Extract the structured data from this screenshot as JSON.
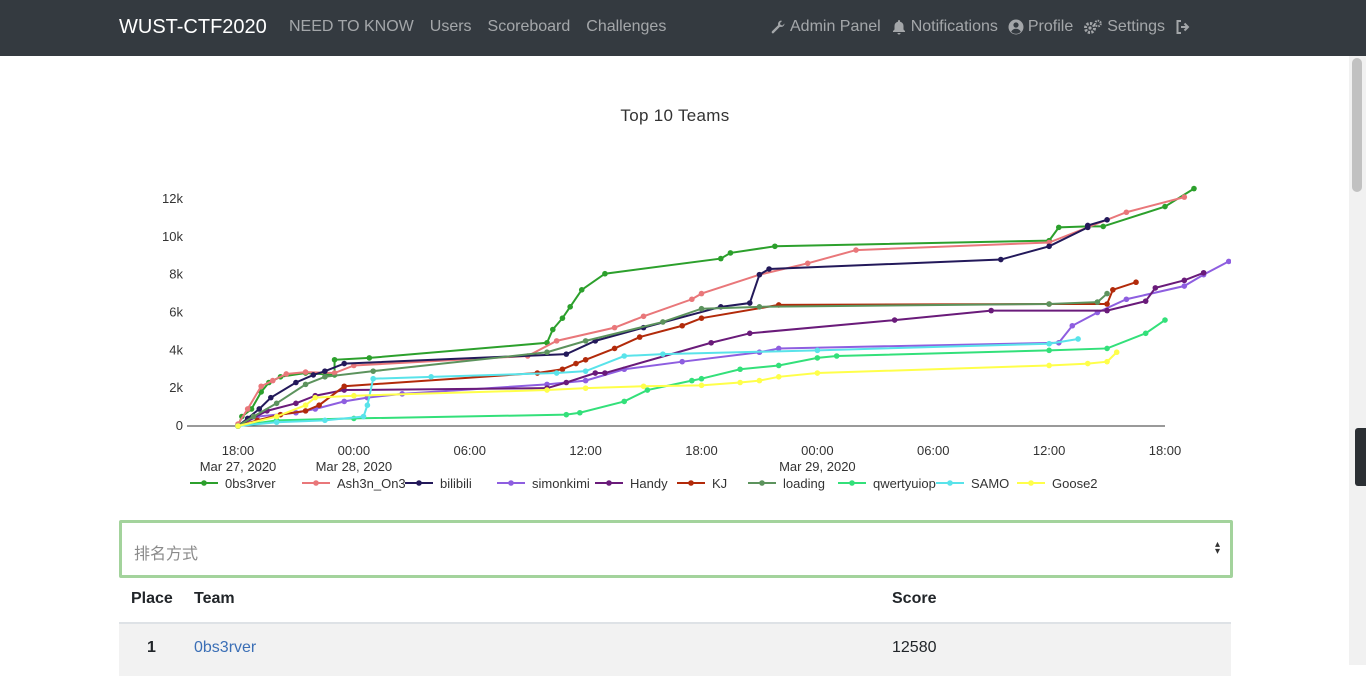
{
  "navbar": {
    "brand": "WUST-CTF2020",
    "left_links": [
      "NEED TO KNOW",
      "Users",
      "Scoreboard",
      "Challenges"
    ],
    "right_links": [
      {
        "label": "Admin Panel",
        "icon": "wrench-icon"
      },
      {
        "label": "Notifications",
        "icon": "bell-icon"
      },
      {
        "label": "Profile",
        "icon": "user-circle-icon"
      },
      {
        "label": "Settings",
        "icon": "cogs-icon"
      }
    ],
    "logout_icon": "sign-out-icon"
  },
  "chart_data": {
    "type": "line",
    "title": "Top 10 Teams",
    "ylim": [
      0,
      13000
    ],
    "yticks": [
      "0",
      "2k",
      "4k",
      "6k",
      "8k",
      "10k",
      "12k"
    ],
    "xticks": [
      {
        "label": "18:00",
        "sub": "Mar 27, 2020"
      },
      {
        "label": "00:00",
        "sub": "Mar 28, 2020"
      },
      {
        "label": "06:00",
        "sub": ""
      },
      {
        "label": "12:00",
        "sub": ""
      },
      {
        "label": "18:00",
        "sub": ""
      },
      {
        "label": "00:00",
        "sub": "Mar 29, 2020"
      },
      {
        "label": "06:00",
        "sub": ""
      },
      {
        "label": "12:00",
        "sub": ""
      },
      {
        "label": "18:00",
        "sub": ""
      }
    ],
    "x_hours": [
      -6,
      0,
      6,
      12,
      18,
      24,
      30,
      36,
      42
    ],
    "x_unit": "hours from Mar 28, 2020 00:00",
    "legend_position": "bottom",
    "series": [
      {
        "name": "0bs3rver",
        "color": "#2ca02c",
        "points": [
          [
            -6,
            0
          ],
          [
            -5.8,
            500
          ],
          [
            -5.3,
            900
          ],
          [
            -4.8,
            1800
          ],
          [
            -4.4,
            2300
          ],
          [
            -3.8,
            2600
          ],
          [
            -2.5,
            2800
          ],
          [
            -1,
            2700
          ],
          [
            -1,
            3500
          ],
          [
            0.8,
            3600
          ],
          [
            10,
            4400
          ],
          [
            10.3,
            5100
          ],
          [
            10.8,
            5700
          ],
          [
            11.2,
            6300
          ],
          [
            11.8,
            7200
          ],
          [
            13,
            8050
          ],
          [
            19,
            8850
          ],
          [
            19.5,
            9150
          ],
          [
            21.8,
            9500
          ],
          [
            36,
            9800
          ],
          [
            36.5,
            10500
          ],
          [
            38,
            10550
          ],
          [
            38.8,
            10550
          ],
          [
            42,
            11600
          ],
          [
            43.5,
            12550
          ]
        ]
      },
      {
        "name": "Ash3n_On3",
        "color": "#e9777a",
        "points": [
          [
            -6,
            100
          ],
          [
            -5.5,
            900
          ],
          [
            -4.8,
            2100
          ],
          [
            -4.2,
            2400
          ],
          [
            -3.5,
            2750
          ],
          [
            -2.5,
            2850
          ],
          [
            -1,
            2800
          ],
          [
            0,
            3200
          ],
          [
            9,
            3700
          ],
          [
            10.5,
            4500
          ],
          [
            13.5,
            5200
          ],
          [
            15,
            5800
          ],
          [
            17.5,
            6700
          ],
          [
            18,
            7000
          ],
          [
            21,
            8000
          ],
          [
            23.5,
            8600
          ],
          [
            26,
            9300
          ],
          [
            36,
            9700
          ],
          [
            38,
            10500
          ],
          [
            40,
            11300
          ],
          [
            43,
            12100
          ]
        ]
      },
      {
        "name": "bilibili",
        "color": "#23195a",
        "points": [
          [
            -6,
            0
          ],
          [
            -5.5,
            400
          ],
          [
            -4.9,
            900
          ],
          [
            -4.3,
            1500
          ],
          [
            -3,
            2300
          ],
          [
            -2.1,
            2700
          ],
          [
            -1.5,
            2900
          ],
          [
            -0.5,
            3300
          ],
          [
            11,
            3800
          ],
          [
            12.5,
            4500
          ],
          [
            15,
            5200
          ],
          [
            19,
            6300
          ],
          [
            20.5,
            6500
          ],
          [
            21,
            8000
          ],
          [
            21.5,
            8300
          ],
          [
            33.5,
            8800
          ],
          [
            36,
            9500
          ],
          [
            38,
            10500
          ],
          [
            38,
            10600
          ],
          [
            39,
            10900
          ]
        ]
      },
      {
        "name": "simonkimi",
        "color": "#8e5ee0",
        "points": [
          [
            -6,
            0
          ],
          [
            -5,
            500
          ],
          [
            -3,
            700
          ],
          [
            -2,
            900
          ],
          [
            -0.5,
            1300
          ],
          [
            0.7,
            1500
          ],
          [
            2.5,
            1700
          ],
          [
            10,
            2200
          ],
          [
            12,
            2400
          ],
          [
            14,
            3000
          ],
          [
            17,
            3400
          ],
          [
            21,
            3900
          ],
          [
            22,
            4100
          ],
          [
            36.5,
            4400
          ],
          [
            37.2,
            5300
          ],
          [
            38.5,
            6000
          ],
          [
            40,
            6700
          ],
          [
            43,
            7400
          ],
          [
            44,
            8000
          ],
          [
            45.3,
            8700
          ]
        ]
      },
      {
        "name": "Handy",
        "color": "#6a1b7a",
        "points": [
          [
            -6,
            0
          ],
          [
            -4.5,
            800
          ],
          [
            -3,
            1200
          ],
          [
            -2,
            1600
          ],
          [
            -0.5,
            1900
          ],
          [
            10,
            2000
          ],
          [
            11,
            2300
          ],
          [
            12.5,
            2800
          ],
          [
            13,
            2800
          ],
          [
            18.5,
            4400
          ],
          [
            20.5,
            4900
          ],
          [
            28,
            5600
          ],
          [
            33,
            6100
          ],
          [
            39,
            6100
          ],
          [
            41,
            6600
          ],
          [
            41.5,
            7300
          ],
          [
            43,
            7700
          ],
          [
            44,
            8100
          ]
        ]
      },
      {
        "name": "KJ",
        "color": "#b22a0a",
        "points": [
          [
            -6,
            0
          ],
          [
            -5,
            300
          ],
          [
            -3.8,
            600
          ],
          [
            -2.5,
            800
          ],
          [
            -1.8,
            1100
          ],
          [
            -0.5,
            2100
          ],
          [
            9.5,
            2800
          ],
          [
            10.8,
            3000
          ],
          [
            11.5,
            3300
          ],
          [
            12,
            3500
          ],
          [
            13.5,
            4100
          ],
          [
            14.8,
            4700
          ],
          [
            17,
            5300
          ],
          [
            18,
            5700
          ],
          [
            22,
            6400
          ],
          [
            36,
            6450
          ],
          [
            39,
            6450
          ],
          [
            39.3,
            7200
          ],
          [
            40.5,
            7600
          ]
        ]
      },
      {
        "name": "loading",
        "color": "#5c935d",
        "points": [
          [
            -6,
            0
          ],
          [
            -5.2,
            500
          ],
          [
            -4,
            1200
          ],
          [
            -2.5,
            2200
          ],
          [
            -1.5,
            2600
          ],
          [
            1,
            2900
          ],
          [
            10,
            3900
          ],
          [
            12,
            4500
          ],
          [
            16,
            5500
          ],
          [
            18,
            6200
          ],
          [
            21,
            6300
          ],
          [
            36,
            6450
          ],
          [
            38.5,
            6550
          ],
          [
            39,
            7000
          ]
        ]
      },
      {
        "name": "qwertyuiop",
        "color": "#33e07a",
        "points": [
          [
            -6,
            0
          ],
          [
            -4,
            300
          ],
          [
            0,
            400
          ],
          [
            11,
            600
          ],
          [
            11.7,
            700
          ],
          [
            14,
            1300
          ],
          [
            15.2,
            1900
          ],
          [
            17.5,
            2400
          ],
          [
            18,
            2500
          ],
          [
            20,
            3000
          ],
          [
            22,
            3200
          ],
          [
            24,
            3600
          ],
          [
            25,
            3700
          ],
          [
            36,
            4000
          ],
          [
            39,
            4100
          ],
          [
            41,
            4900
          ],
          [
            42,
            5600
          ]
        ]
      },
      {
        "name": "SAMO",
        "color": "#59e3ea",
        "points": [
          [
            -6,
            0
          ],
          [
            -4,
            200
          ],
          [
            -1.5,
            300
          ],
          [
            0.5,
            500
          ],
          [
            0.7,
            1100
          ],
          [
            1,
            2500
          ],
          [
            4,
            2600
          ],
          [
            10.5,
            2800
          ],
          [
            12,
            2900
          ],
          [
            14,
            3700
          ],
          [
            16,
            3800
          ],
          [
            24,
            4000
          ],
          [
            36,
            4350
          ],
          [
            37.5,
            4600
          ]
        ]
      },
      {
        "name": "Goose2",
        "color": "#ffff4a",
        "points": [
          [
            -6,
            0
          ],
          [
            -4,
            500
          ],
          [
            -2.5,
            1100
          ],
          [
            -2,
            1500
          ],
          [
            0,
            1600
          ],
          [
            10,
            1900
          ],
          [
            12,
            2000
          ],
          [
            15,
            2100
          ],
          [
            18,
            2150
          ],
          [
            20,
            2300
          ],
          [
            21,
            2400
          ],
          [
            22,
            2600
          ],
          [
            24,
            2800
          ],
          [
            36,
            3200
          ],
          [
            38,
            3300
          ],
          [
            39,
            3400
          ],
          [
            39.5,
            3900
          ]
        ]
      }
    ]
  },
  "sort": {
    "placeholder": "排名方式"
  },
  "table": {
    "headers": {
      "place": "Place",
      "team": "Team",
      "score": "Score"
    },
    "rows": [
      {
        "place": "1",
        "team": "0bs3rver",
        "score": "12580"
      }
    ]
  }
}
